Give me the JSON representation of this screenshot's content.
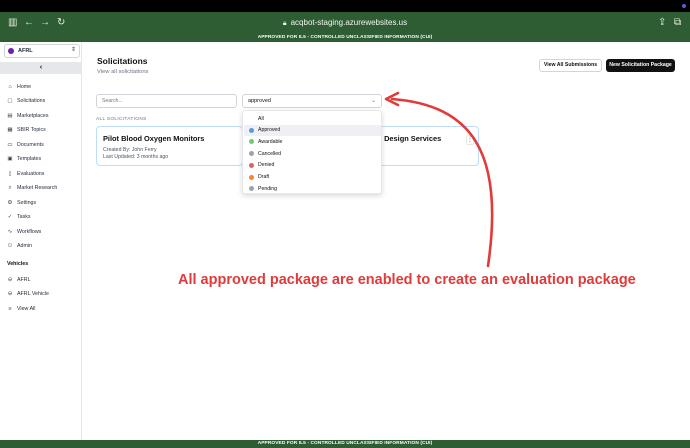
{
  "browser": {
    "url": "acqbot-staging.azurewebsites.us",
    "banner": "APPROVED FOR IL5 - CONTROLLED UNCLASSIFIED INFORMATION (CUI)"
  },
  "sidebar": {
    "org_name": "AFRL",
    "items": [
      {
        "label": "Home",
        "icon": "home-icon",
        "glyph": "⌂"
      },
      {
        "label": "Solicitations",
        "icon": "document-icon",
        "glyph": "▢"
      },
      {
        "label": "Marketplaces",
        "icon": "store-icon",
        "glyph": "▤"
      },
      {
        "label": "SBIR Topics",
        "icon": "grid-icon",
        "glyph": "▦"
      },
      {
        "label": "Documents",
        "icon": "file-icon",
        "glyph": "▭"
      },
      {
        "label": "Templates",
        "icon": "template-icon",
        "glyph": "▣"
      },
      {
        "label": "Evaluations",
        "icon": "clipboard-icon",
        "glyph": "▯"
      },
      {
        "label": "Market Research",
        "icon": "search-icon",
        "glyph": "⌕"
      },
      {
        "label": "Settings",
        "icon": "gear-icon",
        "glyph": "⚙"
      },
      {
        "label": "Tasks",
        "icon": "check-icon",
        "glyph": "✓"
      },
      {
        "label": "Workflows",
        "icon": "workflow-icon",
        "glyph": "∿"
      },
      {
        "label": "Admin",
        "icon": "admin-icon",
        "glyph": "⚇"
      }
    ],
    "vehicles_label": "Vehicles",
    "vehicles": [
      {
        "label": "AFRL",
        "icon": "link-icon",
        "glyph": "⊖"
      },
      {
        "label": "AFRL Vehicle",
        "icon": "link-icon",
        "glyph": "⊖"
      },
      {
        "label": "View All",
        "icon": "list-icon",
        "glyph": "≡"
      }
    ]
  },
  "main": {
    "title": "Solicitations",
    "subtitle": "View all solicitations",
    "view_all_submissions": "View All Submissions",
    "new_package": "New Solicitation Package",
    "search_placeholder": "Search...",
    "filter_value": "approved",
    "all_label": "ALL SOLICITATIONS",
    "cards": [
      {
        "title": "Pilot Blood Oxygen Monitors",
        "created_by": "Created By: John Ferry",
        "updated": "Last Updated: 3 months ago"
      },
      {
        "title": "nd Design Services"
      }
    ],
    "dropdown_options": [
      {
        "label": "All",
        "color": ""
      },
      {
        "label": "Approved",
        "color": "#5b9bd5"
      },
      {
        "label": "Awardable",
        "color": "#6ccf6c"
      },
      {
        "label": "Cancelled",
        "color": "#9ca3af"
      },
      {
        "label": "Denied",
        "color": "#e0625a"
      },
      {
        "label": "Draft",
        "color": "#f08a24"
      },
      {
        "label": "Pending",
        "color": "#9ca3af"
      }
    ]
  },
  "annotation": {
    "text": "All approved package are enabled to create an evaluation package",
    "color": "#e03a3a"
  }
}
